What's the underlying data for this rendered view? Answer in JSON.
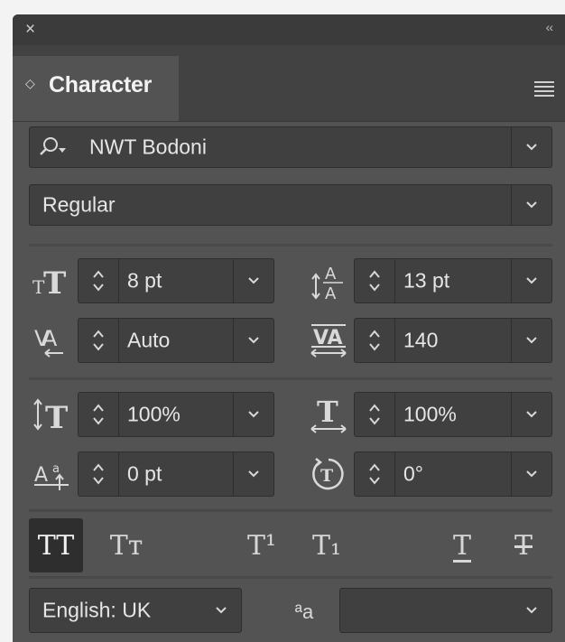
{
  "panel": {
    "close_icon": "×",
    "collapse_icon": "‹‹",
    "tab_title": "Character"
  },
  "font": {
    "family": "NWT Bodoni",
    "style": "Regular"
  },
  "metrics": {
    "font_size": "8 pt",
    "leading": "13 pt",
    "kerning": "Auto",
    "tracking": "140",
    "vertical_scale": "100%",
    "horizontal_scale": "100%",
    "baseline_shift": "0 pt",
    "rotation": "0°"
  },
  "toggles": {
    "all_caps": "TT",
    "small_caps": "Tт",
    "superscript": "T¹",
    "subscript": "T₁",
    "underline": "T",
    "strikethrough": "T"
  },
  "language": {
    "value": "English: UK",
    "antialias_icon": "ªa",
    "antialias_value": ""
  }
}
